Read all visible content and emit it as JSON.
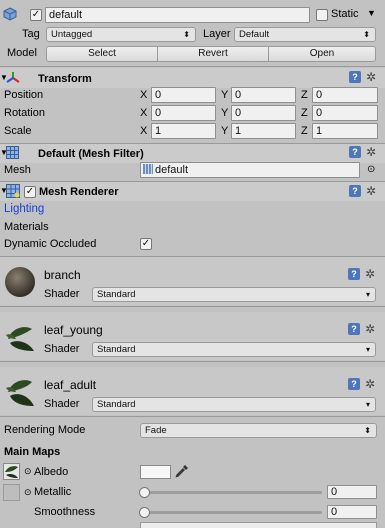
{
  "header": {
    "name": "default",
    "static_label": "Static",
    "tag_label": "Tag",
    "tag_value": "Untagged",
    "layer_label": "Layer",
    "layer_value": "Default",
    "model_label": "Model",
    "buttons": [
      "Select",
      "Revert",
      "Open"
    ]
  },
  "transform": {
    "title": "Transform",
    "rows": [
      {
        "label": "Position",
        "x": "0",
        "y": "0",
        "z": "0"
      },
      {
        "label": "Rotation",
        "x": "0",
        "y": "0",
        "z": "0"
      },
      {
        "label": "Scale",
        "x": "1",
        "y": "1",
        "z": "1"
      }
    ],
    "axis_labels": [
      "X",
      "Y",
      "Z"
    ]
  },
  "mesh_filter": {
    "title": "Default (Mesh Filter)",
    "mesh_label": "Mesh",
    "mesh_value": "default"
  },
  "mesh_renderer": {
    "title": "Mesh Renderer",
    "lighting": "Lighting",
    "materials": "Materials",
    "dynamic_occluded": "Dynamic Occluded"
  },
  "materials": [
    {
      "name": "branch",
      "shader_label": "Shader",
      "shader": "Standard"
    },
    {
      "name": "leaf_young",
      "shader_label": "Shader",
      "shader": "Standard"
    },
    {
      "name": "leaf_adult",
      "shader_label": "Shader",
      "shader": "Standard"
    }
  ],
  "material_props": {
    "rendering_mode_label": "Rendering Mode",
    "rendering_mode": "Fade",
    "main_maps": "Main Maps",
    "albedo": "Albedo",
    "metallic": "Metallic",
    "metallic_value": "0",
    "smoothness": "Smoothness",
    "smoothness_value": "0"
  },
  "colors": {
    "link_blue": "#1a3fd6",
    "help_icon": "#4f77b8"
  }
}
